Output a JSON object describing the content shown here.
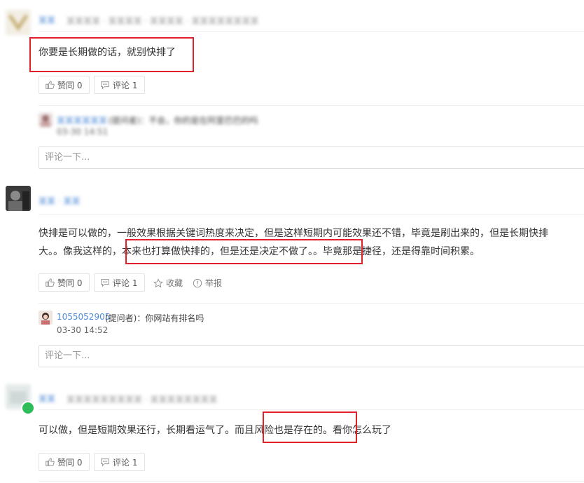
{
  "answers": [
    {
      "user": "某某",
      "meta": "某某某某 · 某某某某 · 某某某某 · 某某某某某某某某",
      "content": "你要是长期做的话，就别快排了",
      "agree_label": "赞同 0",
      "comment_label": "评论 1",
      "reply": {
        "name": "某某某某某某",
        "text": "(提问者)：不会，你的是在阿里巴巴的吗",
        "time": "03-30 14:51"
      },
      "comment_placeholder": "评论一下..."
    },
    {
      "user": "某某 · 某某",
      "content_line1": "快排是可以做的，一般效果根据关键词热度来决定，但是这样短期内可能效果还不错，毕竟是刷出来的，但是长期快排",
      "content_line2": "大。。像我这样的，本来也打算做快排的，但是还是决定不做了。。毕竟那是捷径，还是得靠时间积累。",
      "agree_label": "赞同 0",
      "comment_label": "评论 1",
      "favorite_label": "收藏",
      "report_label": "举报",
      "reply": {
        "name": "1055052905",
        "text": "(提问者)：你网站有排名吗",
        "time": "03-30 14:52"
      },
      "comment_placeholder": "评论一下..."
    },
    {
      "user": "某某",
      "meta": "某某某某某某某某某 · 某某某某某某某某",
      "content": "可以做，但是短期效果还行，长期看运气了。而且风险也是存在的。看你怎么玩了",
      "agree_label": "赞同 0",
      "comment_label": "评论 1"
    }
  ],
  "colors": {
    "link": "#4d8ad6",
    "highlight": "#e0202a"
  }
}
